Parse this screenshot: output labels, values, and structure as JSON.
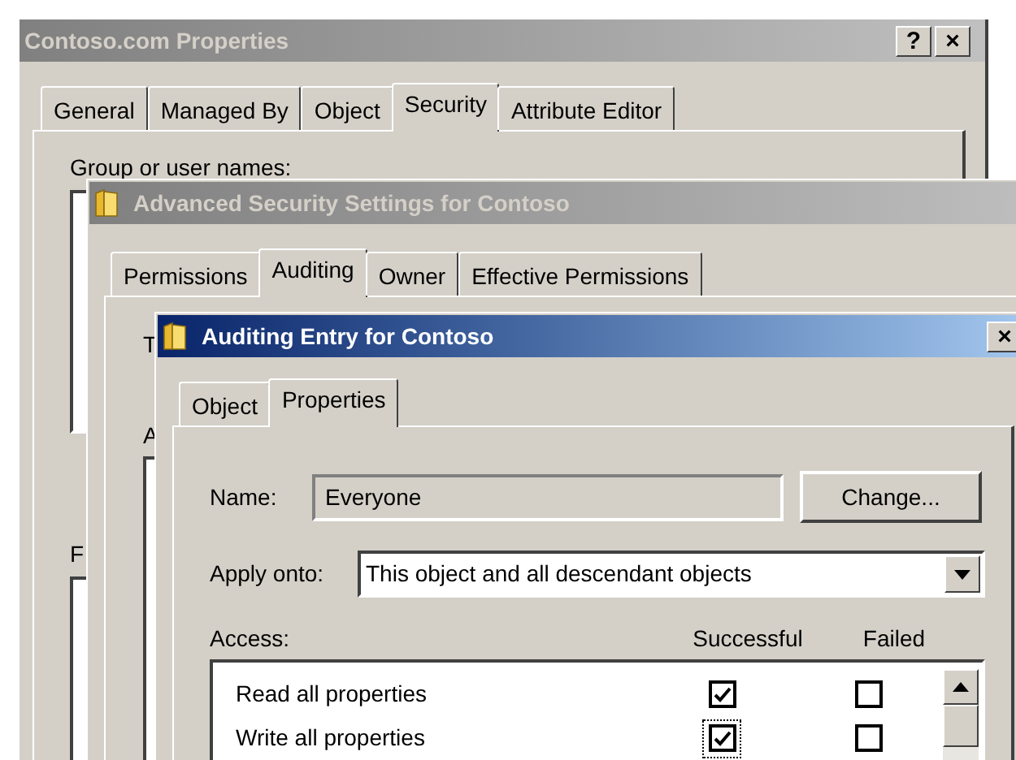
{
  "properties_window": {
    "title": "Contoso.com Properties",
    "active": false,
    "help_button": "?",
    "close_button": "×",
    "tabs": [
      {
        "label": "General",
        "selected": false
      },
      {
        "label": "Managed By",
        "selected": false
      },
      {
        "label": "Object",
        "selected": false
      },
      {
        "label": "Security",
        "selected": true
      },
      {
        "label": "Attribute Editor",
        "selected": false
      }
    ],
    "group_label": "Group or user names:",
    "lower_label": "F"
  },
  "advanced_window": {
    "title": "Advanced Security Settings for Contoso",
    "active": false,
    "tabs": [
      {
        "label": "Permissions",
        "selected": false
      },
      {
        "label": "Auditing",
        "selected": true
      },
      {
        "label": "Owner",
        "selected": false
      },
      {
        "label": "Effective Permissions",
        "selected": false
      }
    ],
    "upper_label": "T",
    "lower_label": "A"
  },
  "entry_window": {
    "title": "Auditing Entry for Contoso",
    "active": true,
    "close_button": "×",
    "tabs": [
      {
        "label": "Object",
        "selected": false
      },
      {
        "label": "Properties",
        "selected": true
      }
    ],
    "name_label": "Name:",
    "name_value": "Everyone",
    "change_button": "Change...",
    "apply_label": "Apply onto:",
    "apply_value": "This object and all descendant objects",
    "access_label": "Access:",
    "columns": [
      "Successful",
      "Failed"
    ],
    "entries": [
      {
        "name": "Read all properties",
        "successful": true,
        "failed": false,
        "focused": false
      },
      {
        "name": "Write all properties",
        "successful": true,
        "failed": false,
        "focused": true
      }
    ]
  }
}
